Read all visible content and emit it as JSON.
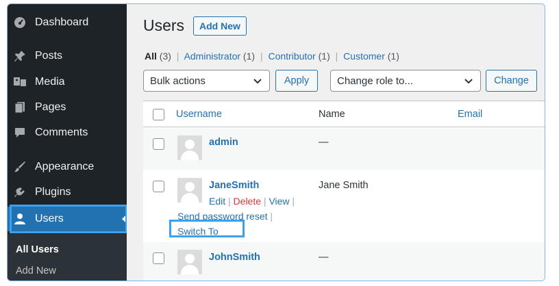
{
  "sidebar": {
    "items": [
      {
        "label": "Dashboard",
        "icon": "dashboard-icon"
      },
      {
        "label": "Posts",
        "icon": "pin-icon"
      },
      {
        "label": "Media",
        "icon": "media-icon"
      },
      {
        "label": "Pages",
        "icon": "pages-icon"
      },
      {
        "label": "Comments",
        "icon": "comments-icon"
      },
      {
        "label": "Appearance",
        "icon": "brush-icon"
      },
      {
        "label": "Plugins",
        "icon": "plug-icon"
      },
      {
        "label": "Users",
        "icon": "user-icon",
        "active": true
      }
    ],
    "submenu": [
      {
        "label": "All Users",
        "current": true
      },
      {
        "label": "Add New"
      }
    ]
  },
  "header": {
    "title": "Users",
    "add_new": "Add New"
  },
  "filters": {
    "all": {
      "label": "All",
      "count": "(3)"
    },
    "administrator": {
      "label": "Administrator",
      "count": "(1)"
    },
    "contributor": {
      "label": "Contributor",
      "count": "(1)"
    },
    "customer": {
      "label": "Customer",
      "count": "(1)"
    },
    "separator": "|"
  },
  "toolbar": {
    "bulk_actions": "Bulk actions",
    "apply": "Apply",
    "change_role": "Change role to...",
    "change": "Change"
  },
  "table": {
    "columns": {
      "username": "Username",
      "name": "Name",
      "email": "Email"
    },
    "rows": [
      {
        "username": "admin",
        "name": "—"
      },
      {
        "username": "JaneSmith",
        "name": "Jane Smith",
        "actions": {
          "edit": "Edit",
          "delete": "Delete",
          "view": "View",
          "reset": "Send password reset",
          "switch": "Switch To",
          "sep": "|"
        }
      },
      {
        "username": "JohnSmith",
        "name": "—"
      }
    ]
  },
  "colors": {
    "accent": "#2271b1",
    "sidebar_bg": "#1d2327",
    "highlight": "#3aa0ef",
    "delete": "#d63638"
  }
}
